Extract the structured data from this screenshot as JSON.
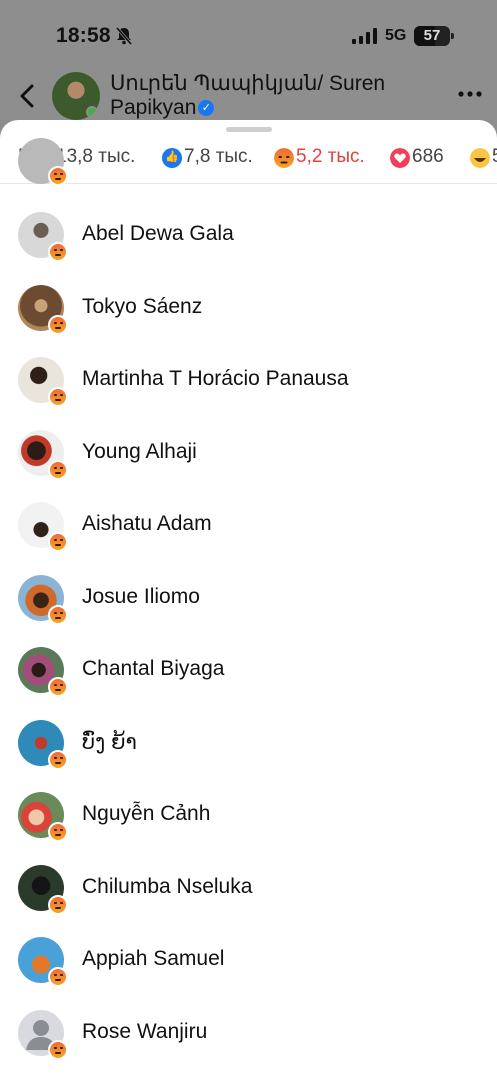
{
  "status_bar": {
    "time": "18:58",
    "network": "5G",
    "battery": "57",
    "battery_level_percent": 57
  },
  "header": {
    "page_name": "Սուրեն Պապիկյան/ Suren Papikyan",
    "verified_glyph": "✓"
  },
  "tabs": [
    {
      "label": "Все 13,8 тыс.",
      "icon": "none"
    },
    {
      "label": "7,8 тыс.",
      "icon": "like-icon"
    },
    {
      "label": "5,2 тыс.",
      "icon": "angry-icon",
      "active": true
    },
    {
      "label": "686",
      "icon": "love-icon"
    },
    {
      "label": "5",
      "icon": "haha-icon"
    }
  ],
  "reactors": [
    {
      "name": "Abel Dewa Gala"
    },
    {
      "name": "Tokyo Sáenz"
    },
    {
      "name": "Martinha T Horácio Panausa"
    },
    {
      "name": "Young Alhaji"
    },
    {
      "name": "Aishatu Adam"
    },
    {
      "name": "Josue Iliomo"
    },
    {
      "name": "Chantal Biyaga"
    },
    {
      "name": "ບົ່ງ ຍ້າ"
    },
    {
      "name": "Nguyễn Cảnh"
    },
    {
      "name": "Chilumba Nseluka"
    },
    {
      "name": "Appiah Samuel"
    },
    {
      "name": "Rose Wanjiru"
    }
  ],
  "colors": {
    "accent_active_tab": "#e4413a",
    "like_blue": "#1877f2",
    "love_red": "#f33e58"
  }
}
